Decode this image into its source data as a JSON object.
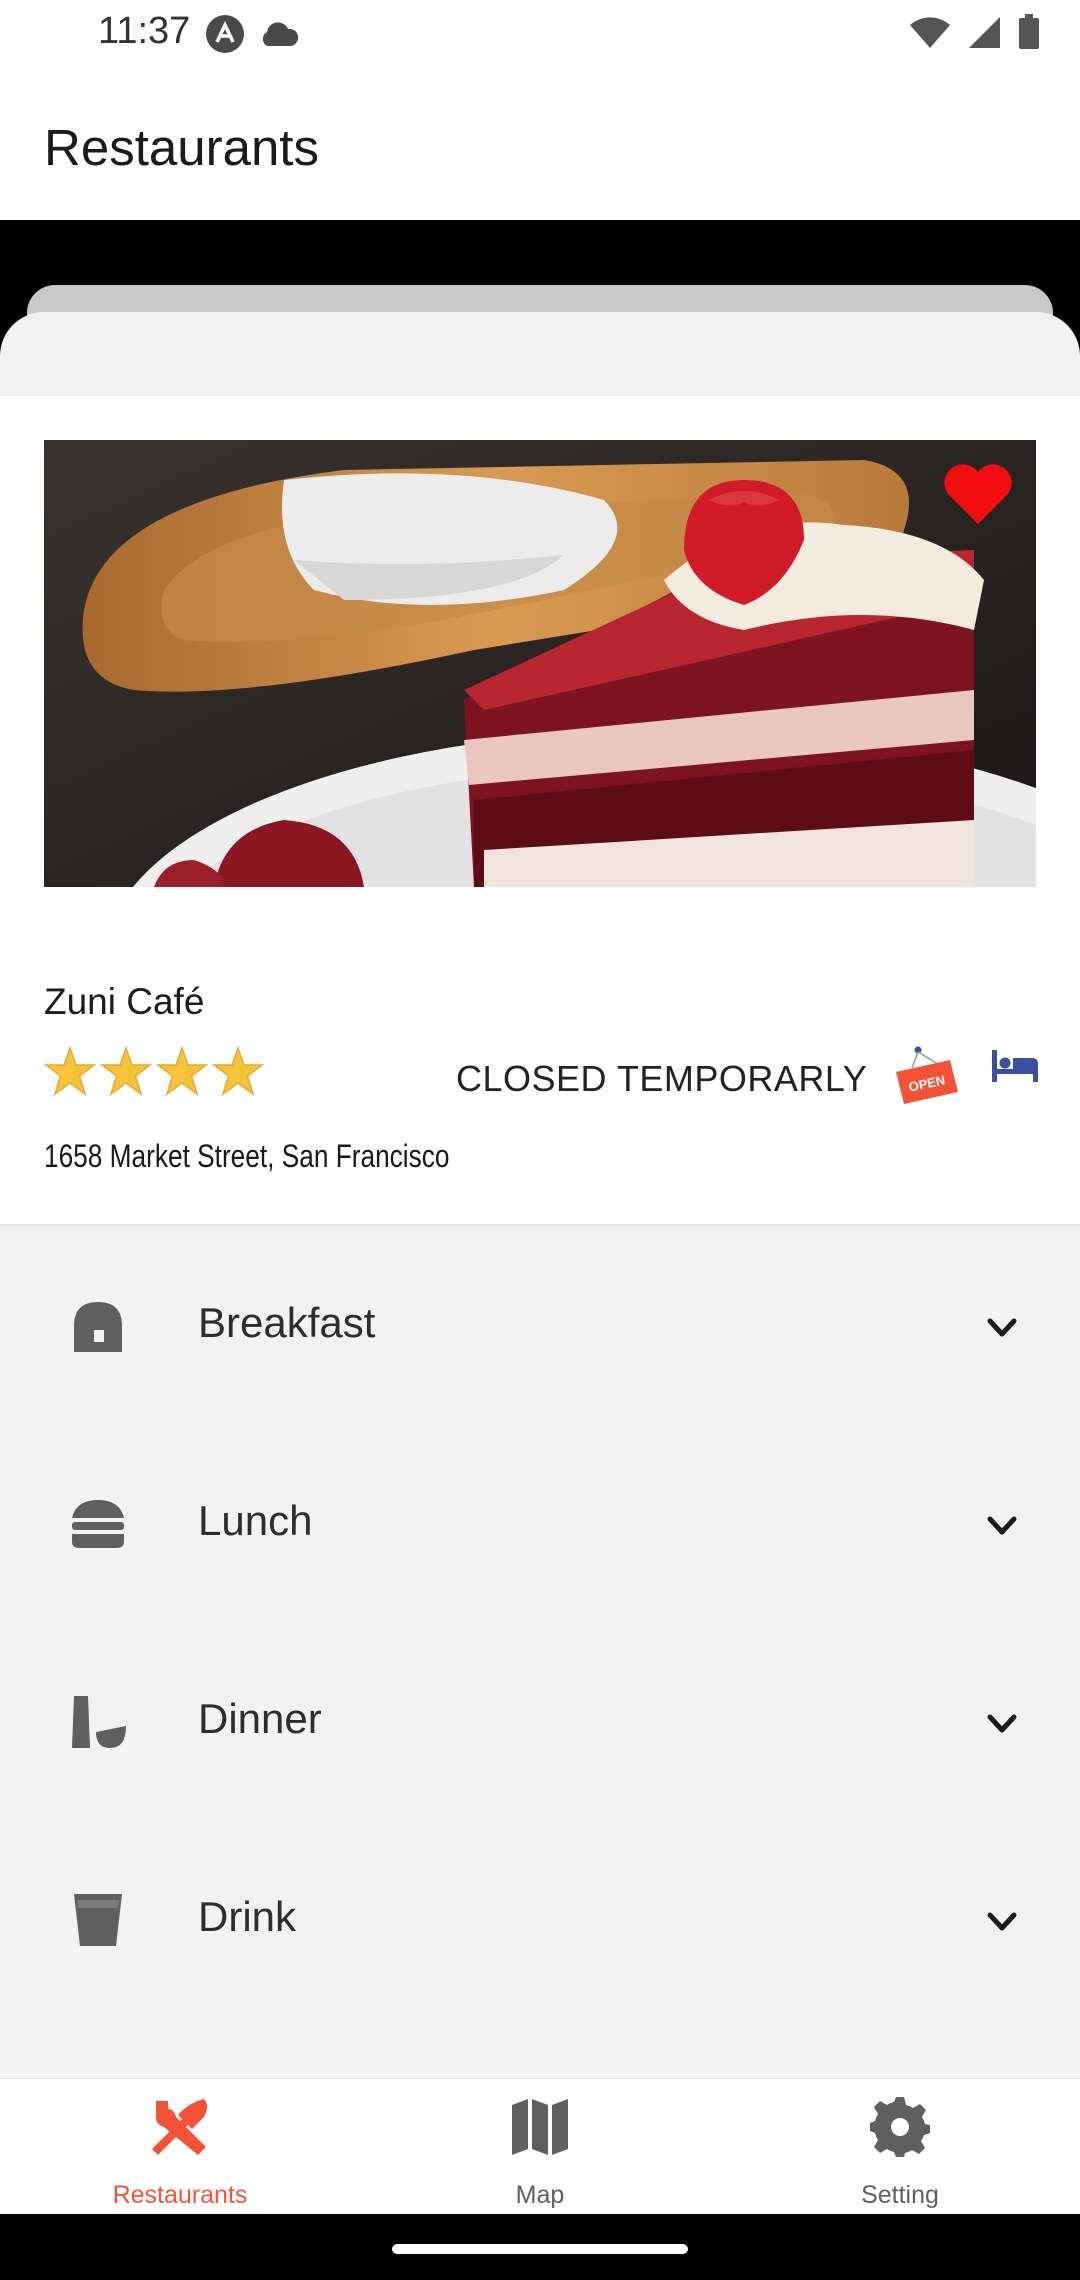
{
  "status_bar": {
    "time": "11:37",
    "left_icons": [
      "app-notification-icon",
      "cloud-icon"
    ],
    "right_icons": [
      "wifi-icon",
      "signal-icon",
      "battery-icon"
    ]
  },
  "app_bar": {
    "title": "Restaurants"
  },
  "restaurant": {
    "name": "Zuni Café",
    "rating": 4,
    "rating_max": 4,
    "status": "CLOSED TEMPORARLY",
    "address": "1658 Market Street, San Francisco",
    "favorite": true,
    "icons": [
      "heart-icon",
      "open-sign-icon",
      "bed-icon"
    ]
  },
  "menu": {
    "items": [
      {
        "label": "Breakfast",
        "icon": "bread-icon"
      },
      {
        "label": "Lunch",
        "icon": "burger-icon"
      },
      {
        "label": "Dinner",
        "icon": "bottle-bowl-icon"
      },
      {
        "label": "Drink",
        "icon": "glass-icon"
      }
    ]
  },
  "bottom_nav": {
    "items": [
      {
        "label": "Restaurants",
        "icon": "utensils-icon",
        "active": true
      },
      {
        "label": "Map",
        "icon": "map-icon",
        "active": false
      },
      {
        "label": "Setting",
        "icon": "gear-icon",
        "active": false
      }
    ]
  },
  "colors": {
    "accent": "#f4533a",
    "heart": "#f20d12",
    "star": "#f7c53c",
    "icon_gray": "#5f5f5f",
    "bed_blue": "#3a4fa0"
  }
}
